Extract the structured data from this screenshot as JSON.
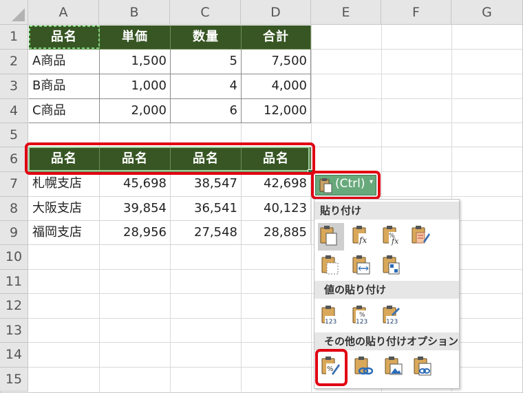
{
  "columns": [
    "A",
    "B",
    "C",
    "D",
    "E",
    "F",
    "G"
  ],
  "rows": [
    "1",
    "2",
    "3",
    "4",
    "5",
    "6",
    "7",
    "8",
    "9",
    "10",
    "11",
    "12",
    "13",
    "14",
    "15"
  ],
  "cells": {
    "r1": [
      "品名",
      "単価",
      "数量",
      "合計"
    ],
    "r2": [
      "A商品",
      "1,500",
      "5",
      "7,500"
    ],
    "r3": [
      "B商品",
      "1,000",
      "4",
      "4,000"
    ],
    "r4": [
      "C商品",
      "2,000",
      "6",
      "12,000"
    ],
    "r6": [
      "品名",
      "品名",
      "品名",
      "品名"
    ],
    "r7": [
      "札幌支店",
      "45,698",
      "38,547",
      "42,698"
    ],
    "r8": [
      "大阪支店",
      "39,854",
      "36,541",
      "40,123"
    ],
    "r9": [
      "福岡支店",
      "28,956",
      "27,548",
      "28,885"
    ]
  },
  "paste_button": {
    "label": "(Ctrl)"
  },
  "paste_menu": {
    "section_paste": "貼り付け",
    "section_values": "値の貼り付け",
    "section_other": "その他の貼り付けオプション",
    "value_icon_text": "123",
    "pct_text": "%",
    "fx_text": "fx"
  },
  "colors": {
    "header_fill": "#375623",
    "highlight": "#e00012",
    "ctrl_button": "#5a9e6f"
  },
  "icons": {
    "paste": [
      "paste-icon",
      "paste-formulas-icon",
      "paste-formulas-number-format-icon",
      "paste-keep-source-formatting-icon",
      "paste-no-borders-icon",
      "paste-keep-column-widths-icon",
      "paste-transpose-icon"
    ],
    "values": [
      "paste-values-icon",
      "paste-values-number-format-icon",
      "paste-values-source-formatting-icon"
    ],
    "other": [
      "paste-formatting-icon",
      "paste-link-icon",
      "paste-picture-icon",
      "paste-linked-picture-icon"
    ]
  }
}
